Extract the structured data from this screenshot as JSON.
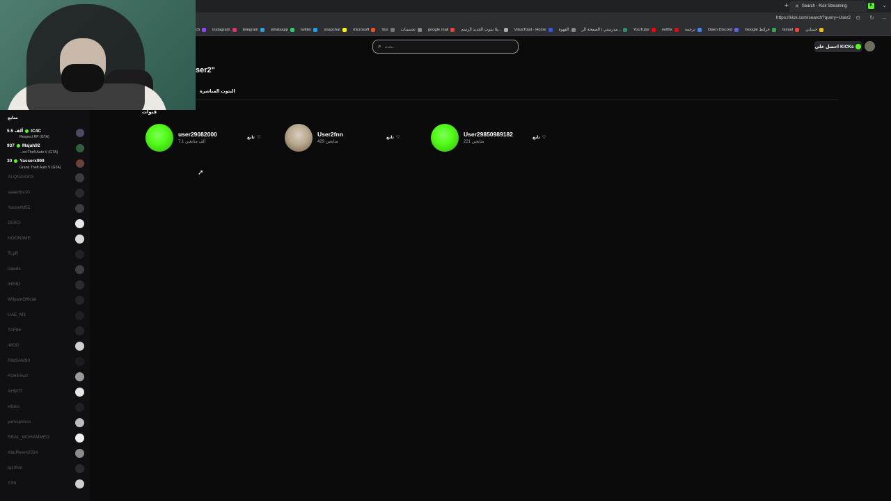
{
  "browser": {
    "tab_title": "Search - Kick Streaming",
    "url": "https://kick.com/search?query=User2",
    "bookmarks": [
      {
        "label": "ch",
        "color": "#9146ff"
      },
      {
        "label": "instagram",
        "color": "#e1306c"
      },
      {
        "label": "telegram",
        "color": "#2aa1da"
      },
      {
        "label": "whatsapp",
        "color": "#25d366"
      },
      {
        "label": "twitter",
        "color": "#1da1f2"
      },
      {
        "label": "snapchat",
        "color": "#fffc00"
      },
      {
        "label": "microsoft",
        "color": "#f25022"
      },
      {
        "label": "lms",
        "color": "#777777"
      },
      {
        "label": "تحسينات",
        "color": "#888888"
      },
      {
        "label": "google mail",
        "color": "#ea4335"
      },
      {
        "label": "يلا شوت الجديد الرسم...",
        "color": "#aaaaaa"
      },
      {
        "label": "VirusTotal - Home",
        "color": "#3955f6"
      },
      {
        "label": "القهوة",
        "color": "#888888"
      },
      {
        "label": "مدرستي | الصفحة الر...",
        "color": "#2b8c6f"
      },
      {
        "label": "YouTube",
        "color": "#ff0000"
      },
      {
        "label": "netflix",
        "color": "#e50914"
      },
      {
        "label": "ترجمة",
        "color": "#4285f4"
      },
      {
        "label": "Open Discord",
        "color": "#5865f2"
      },
      {
        "label": "Google خرائط",
        "color": "#34a853"
      },
      {
        "label": "Gmail",
        "color": "#ea4335"
      },
      {
        "label": "حسابي",
        "color": "#fbbc05"
      }
    ]
  },
  "header": {
    "search_placeholder": "بحث",
    "kicks_button": "احصل على KICKs"
  },
  "main": {
    "query_title": "ser2\"",
    "tab_live": "البثوث المباشرة",
    "channels_heading": "قنوات",
    "follow_label": "تابع",
    "channels": [
      {
        "name": "user29082000",
        "followers": "7.1 ألف متابعين",
        "avatar": "green"
      },
      {
        "name": "User2fnn",
        "followers": "429 متابعين",
        "avatar": "face"
      },
      {
        "name": "User29850989182",
        "followers": "221 متابعين",
        "avatar": "green"
      }
    ]
  },
  "sidebar": {
    "heading": "متابع",
    "live": [
      {
        "count": "5.5 ألف",
        "name": "IC4C",
        "category": "Respect RP (GTA)"
      },
      {
        "count": "937",
        "name": "Majah92",
        "category": "...nd Theft Auto V (GTA)"
      },
      {
        "count": "30",
        "name": "Yasserx999",
        "category": "Grand Theft Auto V (GTA)"
      }
    ],
    "offline": [
      "ALQNAS303",
      "saaedov10",
      "YasserM55",
      "ZERO",
      "NOON3ME",
      "TLyR",
      "isaedx",
      "iHIMO",
      "WilyamOfficial",
      "UAE_M1",
      "TAF86",
      "iMOD",
      "RWSAM90",
      "FARESwz",
      "AHM77",
      "elbiko",
      "yamsprince",
      "REAL_MOHAMMED",
      "AbuReem2024",
      "bj10hm",
      "SX8"
    ]
  }
}
